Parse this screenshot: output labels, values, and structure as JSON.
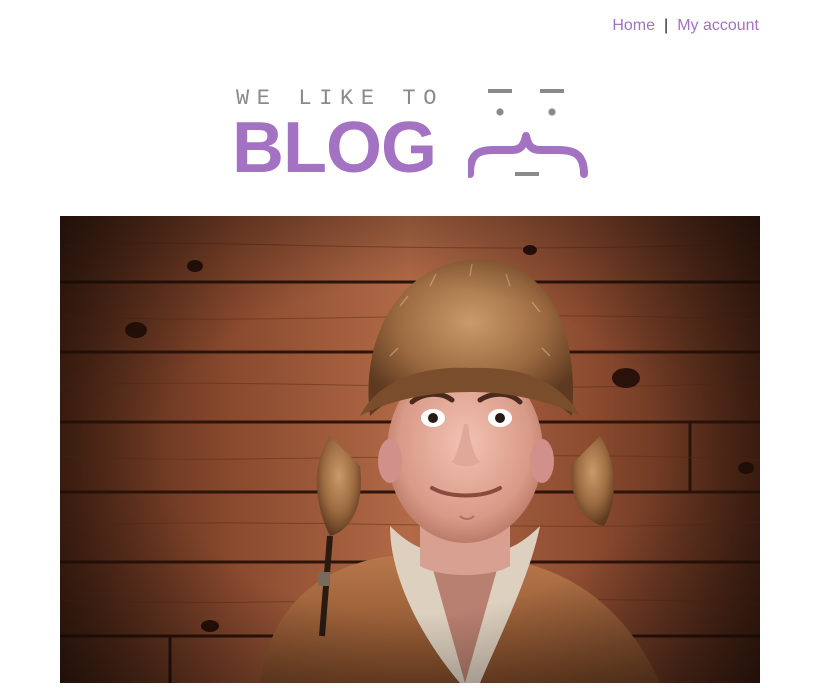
{
  "nav": {
    "home_label": "Home",
    "separator": "|",
    "account_label": "My account"
  },
  "logo": {
    "tagline": "WE LIKE TO",
    "wordmark": "BLOG"
  },
  "colors": {
    "accent": "#a472c3",
    "tagline_gray": "#8a8a8a",
    "wood": "#8a4a2c"
  },
  "hero": {
    "subject": "man-in-fur-hat-photo"
  }
}
